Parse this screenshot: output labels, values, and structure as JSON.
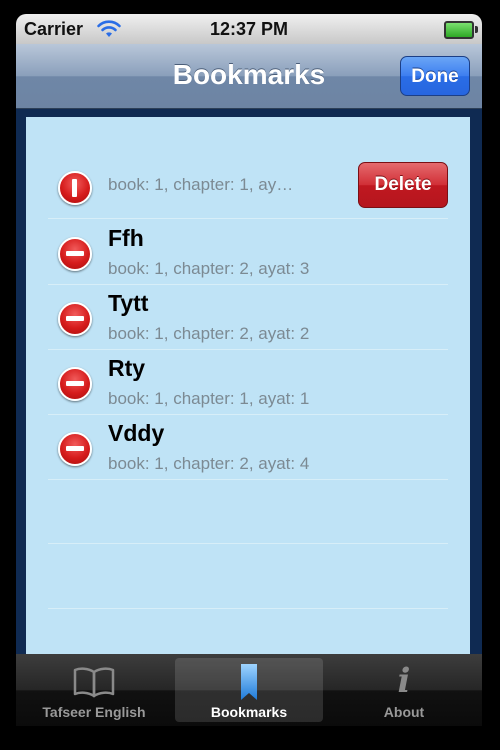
{
  "status_bar": {
    "carrier": "Carrier",
    "time": "12:37 PM",
    "wifi_icon": "wifi-icon",
    "battery_icon": "battery-icon"
  },
  "nav_bar": {
    "title": "Bookmarks",
    "done_label": "Done"
  },
  "bookmarks": [
    {
      "title": "",
      "subtitle": "book: 1, chapter: 1, ay…",
      "delete_label": "Delete",
      "icon": "delete-confirm-icon"
    },
    {
      "title": "Ffh",
      "subtitle": "book: 1, chapter: 2, ayat: 3",
      "icon": "minus-circle-icon"
    },
    {
      "title": "Tytt",
      "subtitle": "book: 1, chapter: 2, ayat: 2",
      "icon": "minus-circle-icon"
    },
    {
      "title": "Rty",
      "subtitle": "book: 1, chapter: 1, ayat: 1",
      "icon": "minus-circle-icon"
    },
    {
      "title": "Vddy",
      "subtitle": "book: 1, chapter: 2, ayat: 4",
      "icon": "minus-circle-icon"
    }
  ],
  "tab_bar": {
    "tabs": [
      {
        "label": "Tafseer English",
        "icon": "book-icon",
        "selected": false
      },
      {
        "label": "Bookmarks",
        "icon": "bookmark-icon",
        "selected": true
      },
      {
        "label": "About",
        "icon": "info-icon",
        "selected": false
      }
    ]
  },
  "colors": {
    "table_background": "#bfe3f6",
    "delete_red": "#c01820",
    "done_blue": "#2a6de6"
  }
}
